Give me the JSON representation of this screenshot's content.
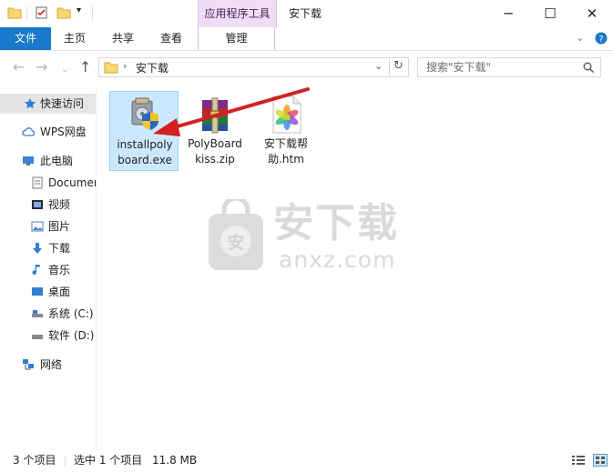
{
  "titlebar": {
    "context_tab": "应用程序工具",
    "window_title": "安下载",
    "minimize": "─",
    "maximize": "☐",
    "close": "✕"
  },
  "ribbon": {
    "file": "文件",
    "home": "主页",
    "share": "共享",
    "view": "查看",
    "manage": "管理"
  },
  "address": {
    "path": "安下载",
    "search_placeholder": "搜索\"安下载\""
  },
  "nav": {
    "quick_access": "快速访问",
    "wps": "WPS网盘",
    "this_pc": "此电脑",
    "documents": "Documer",
    "videos": "视频",
    "pictures": "图片",
    "downloads": "下载",
    "music": "音乐",
    "desktop": "桌面",
    "drive_c": "系统 (C:)",
    "drive_d": "软件 (D:)",
    "network": "网络"
  },
  "files": [
    {
      "line1": "installpoly",
      "line2": "board.exe"
    },
    {
      "line1": "PolyBoard",
      "line2": "kiss.zip"
    },
    {
      "line1": "安下载帮",
      "line2": "助.htm"
    }
  ],
  "status": {
    "count": "3 个项目",
    "selected": "选中 1 个项目",
    "size": "11.8 MB"
  },
  "watermark": {
    "cn": "安下载",
    "en": "anxz.com",
    "badge": "安"
  },
  "colors": {
    "accent": "#1979ca",
    "context_tab": "#f1dcf6",
    "selection": "#cce8ff",
    "arrow": "#d42020"
  }
}
